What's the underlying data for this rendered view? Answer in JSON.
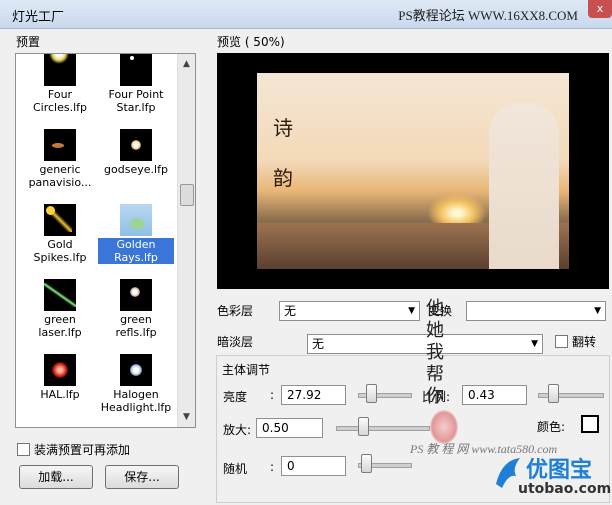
{
  "window": {
    "title": "灯光工厂",
    "watermark": "PS教程论坛 WWW.16XX8.COM",
    "close_label": "x"
  },
  "presets": {
    "label": "预置",
    "items": [
      {
        "name": "Four\nCircles.lfp",
        "thumb": "four-circles"
      },
      {
        "name": "Four Point\nStar.lfp",
        "thumb": "four-point-star"
      },
      {
        "name": "generic\npanavisio...",
        "thumb": "generic-panavision"
      },
      {
        "name": "godseye.lfp",
        "thumb": "godseye"
      },
      {
        "name": "Gold\nSpikes.lfp",
        "thumb": "gold-spikes"
      },
      {
        "name": "Golden\nRays.lfp",
        "thumb": "golden-rays",
        "selected": true
      },
      {
        "name": "green\nlaser.lfp",
        "thumb": "green-laser"
      },
      {
        "name": "green\nrefls.lfp",
        "thumb": "green-refls"
      },
      {
        "name": "HAL.lfp",
        "thumb": "hal"
      },
      {
        "name": "Halogen\nHeadlight.lfp",
        "thumb": "halogen-headlight"
      }
    ],
    "fill_checkbox_label": "装满预置可再添加",
    "load_button": "加载...",
    "save_button": "保存..."
  },
  "preview": {
    "label": "预览 (  50%)",
    "image_text": "诗\n韵"
  },
  "layers": {
    "color_layer_label": "色彩层",
    "color_layer_value": "无",
    "transform_label": "变换",
    "transform_value": "",
    "fade_layer_label": "暗淡层",
    "fade_layer_value": "无",
    "flip_label": "翻转"
  },
  "adjust": {
    "group_label": "主体调节",
    "brightness_label": "亮度",
    "brightness_colon": ":",
    "brightness_value": "27.92",
    "scale_label": "比例:",
    "scale_value": "0.43",
    "zoom_label": "放大:",
    "zoom_value": "0.50",
    "color_label": "颜色:",
    "random_label": "随机",
    "random_colon": ":",
    "random_value": "0"
  },
  "overlay": {
    "seal_text": "他\n她\n我\n帮\n你",
    "ps_watermark": "PS 教 程 网   www.tata580.com",
    "brand_name": "优图宝",
    "brand_url": "utobao.com"
  },
  "colors": {
    "selection": "#3a76d8",
    "brand_blue": "#1e7fd6"
  }
}
